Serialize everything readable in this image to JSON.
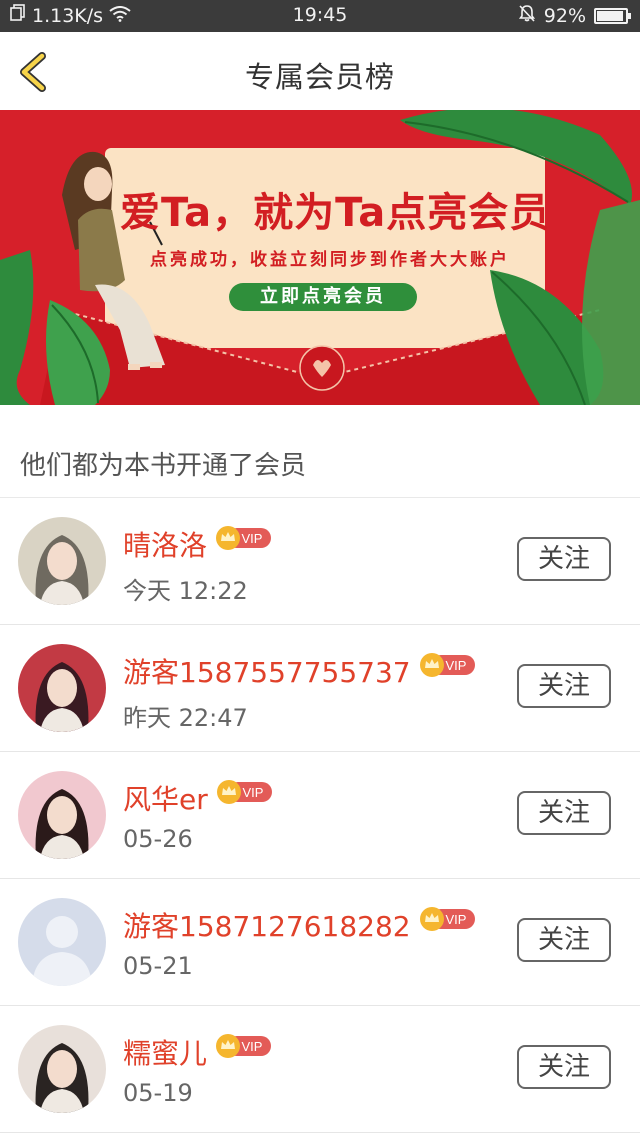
{
  "status_bar": {
    "network_speed": "1.13K/s",
    "time": "19:45",
    "battery": "92%",
    "battery_level": 0.92
  },
  "navbar": {
    "back_icon": "chevron-left-icon",
    "title": "专属会员榜"
  },
  "banner": {
    "headline": "爱Ta，就为Ta点亮会员",
    "subline": "点亮成功，收益立刻同步到作者大大账户",
    "cta_label": "立即点亮会员"
  },
  "section": {
    "title": "他们都为本书开通了会员"
  },
  "vip_label": "VIP",
  "members": [
    {
      "name": "晴洛洛",
      "time": "今天 12:22",
      "follow_label": "关注",
      "avatar_colors": [
        "#d9d3c4",
        "#6f6a60"
      ]
    },
    {
      "name": "游客1587557755737",
      "time": "昨天 22:47",
      "follow_label": "关注",
      "avatar_colors": [
        "#c23a44",
        "#3a1a22"
      ]
    },
    {
      "name": "风华er",
      "time": "05-26",
      "follow_label": "关注",
      "avatar_colors": [
        "#f1c8cf",
        "#2b1a1a"
      ]
    },
    {
      "name": "游客1587127618282",
      "time": "05-21",
      "follow_label": "关注",
      "avatar_colors": [
        "#d5dcea",
        "#eef1f7"
      ]
    },
    {
      "name": "糯蜜儿",
      "time": "05-19",
      "follow_label": "关注",
      "avatar_colors": [
        "#e8e0da",
        "#2a2422"
      ]
    }
  ],
  "colors": {
    "accent_name": "#e0412a",
    "banner_red": "#d6202a",
    "cta_green": "#2f8f3b",
    "vip_gold": "#f5b62e",
    "vip_red": "#e35b57"
  }
}
